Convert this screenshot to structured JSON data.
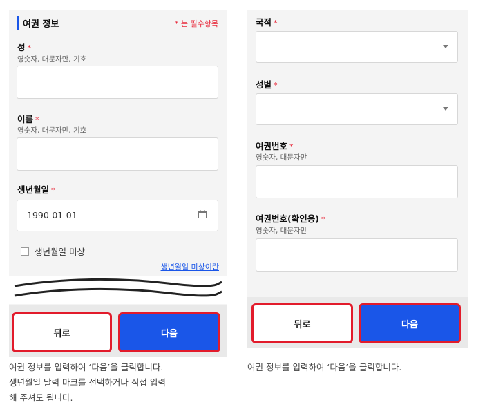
{
  "left": {
    "section_title": "여권 정보",
    "required_note": "* 는 필수항목",
    "surname": {
      "label": "성",
      "hint": "영숫자, 대문자만, 기호",
      "value": ""
    },
    "given_name": {
      "label": "이름",
      "hint": "영숫자, 대문자만, 기호",
      "value": ""
    },
    "birthdate": {
      "label": "생년월일",
      "value": "1990-01-01",
      "icon": "calendar-icon"
    },
    "unknown_birthdate": {
      "label": "생년월일 미상",
      "checked": false
    },
    "unknown_link": "생년월일 미상이란",
    "back_button": "뒤로",
    "next_button": "다음",
    "caption_lines": [
      "여권 정보를 입력하여 ‘다음’을 클릭합니다.",
      "생년월일 달력 마크를 선택하거나 직접 입력",
      "해 주셔도 됩니다."
    ]
  },
  "right": {
    "nationality": {
      "label": "국적",
      "value": "-"
    },
    "gender": {
      "label": "성별",
      "value": "-"
    },
    "passport_no": {
      "label": "여권번호",
      "hint": "영숫자, 대문자만",
      "value": ""
    },
    "passport_confirm": {
      "label": "여권번호(확인용)",
      "hint": "영숫자, 대문자만",
      "value": ""
    },
    "back_button": "뒤로",
    "next_button": "다음",
    "caption": "여권 정보를 입력하여 ‘다음’을 클릭합니다."
  },
  "required_mark": "*",
  "colors": {
    "accent": "#1a56e8",
    "required": "#e8283a",
    "highlight_border": "#e21b2b"
  }
}
